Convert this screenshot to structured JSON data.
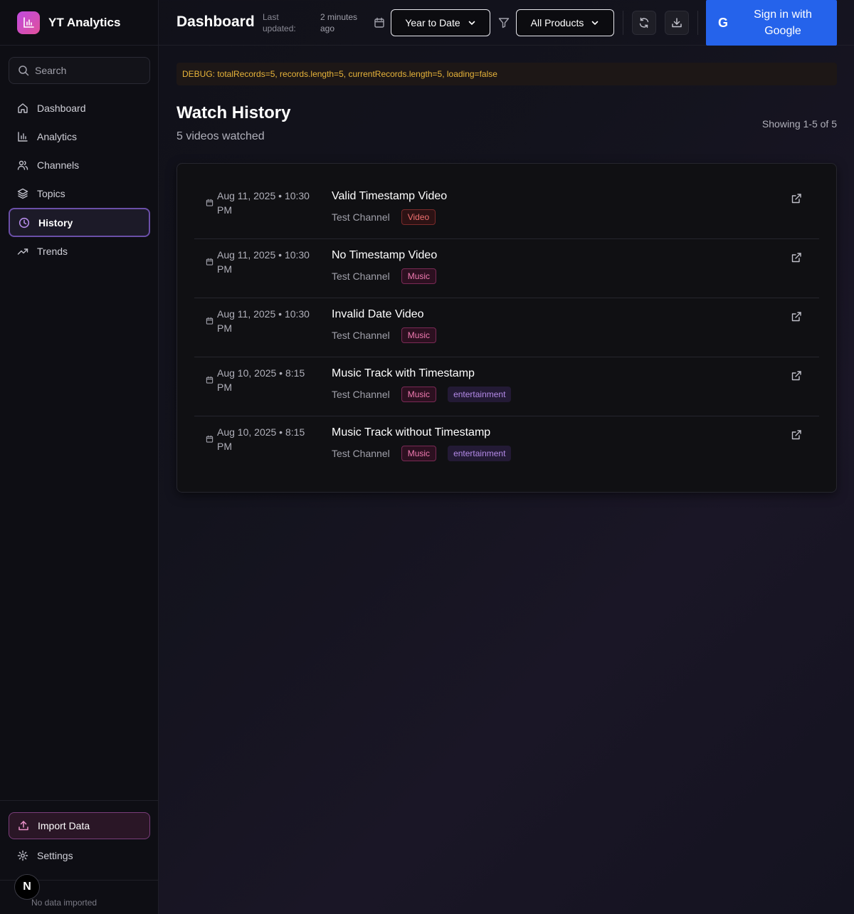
{
  "app": {
    "name": "YT Analytics"
  },
  "sidebar": {
    "search_placeholder": "Search",
    "items": [
      {
        "label": "Dashboard",
        "icon": "home-icon"
      },
      {
        "label": "Analytics",
        "icon": "bar-chart-icon"
      },
      {
        "label": "Channels",
        "icon": "users-icon"
      },
      {
        "label": "Topics",
        "icon": "layers-icon"
      },
      {
        "label": "History",
        "icon": "clock-icon",
        "active": true
      },
      {
        "label": "Trends",
        "icon": "trending-up-icon"
      }
    ],
    "import_label": "Import Data",
    "settings_label": "Settings",
    "footer_status": "No data imported",
    "badge": "N"
  },
  "header": {
    "title": "Dashboard",
    "last_updated_label": "Last updated:",
    "last_updated_value": "2 minutes ago",
    "date_range": "Year to Date",
    "product_filter": "All Products",
    "google_signin": "Sign in with Google",
    "google_glyph": "G"
  },
  "debug": "DEBUG: totalRecords=5, records.length=5, currentRecords.length=5, loading=false",
  "history": {
    "title": "Watch History",
    "subtitle": "5 videos watched",
    "showing": "Showing 1-5 of 5",
    "rows": [
      {
        "date": "Aug 11, 2025 • 10:30 PM",
        "title": "Valid Timestamp Video",
        "channel": "Test Channel",
        "tags": [
          "Video"
        ]
      },
      {
        "date": "Aug 11, 2025 • 10:30 PM",
        "title": "No Timestamp Video",
        "channel": "Test Channel",
        "tags": [
          "Music"
        ]
      },
      {
        "date": "Aug 11, 2025 • 10:30 PM",
        "title": "Invalid Date Video",
        "channel": "Test Channel",
        "tags": [
          "Music"
        ]
      },
      {
        "date": "Aug 10, 2025 • 8:15 PM",
        "title": "Music Track with Timestamp",
        "channel": "Test Channel",
        "tags": [
          "Music",
          "entertainment"
        ]
      },
      {
        "date": "Aug 10, 2025 • 8:15 PM",
        "title": "Music Track without Timestamp",
        "channel": "Test Channel",
        "tags": [
          "Music",
          "entertainment"
        ]
      }
    ]
  },
  "colors": {
    "accent": "#2563eb",
    "brand_gradient_start": "#c04be0",
    "brand_gradient_end": "#e0509a",
    "active_border": "#6b4fa8"
  }
}
